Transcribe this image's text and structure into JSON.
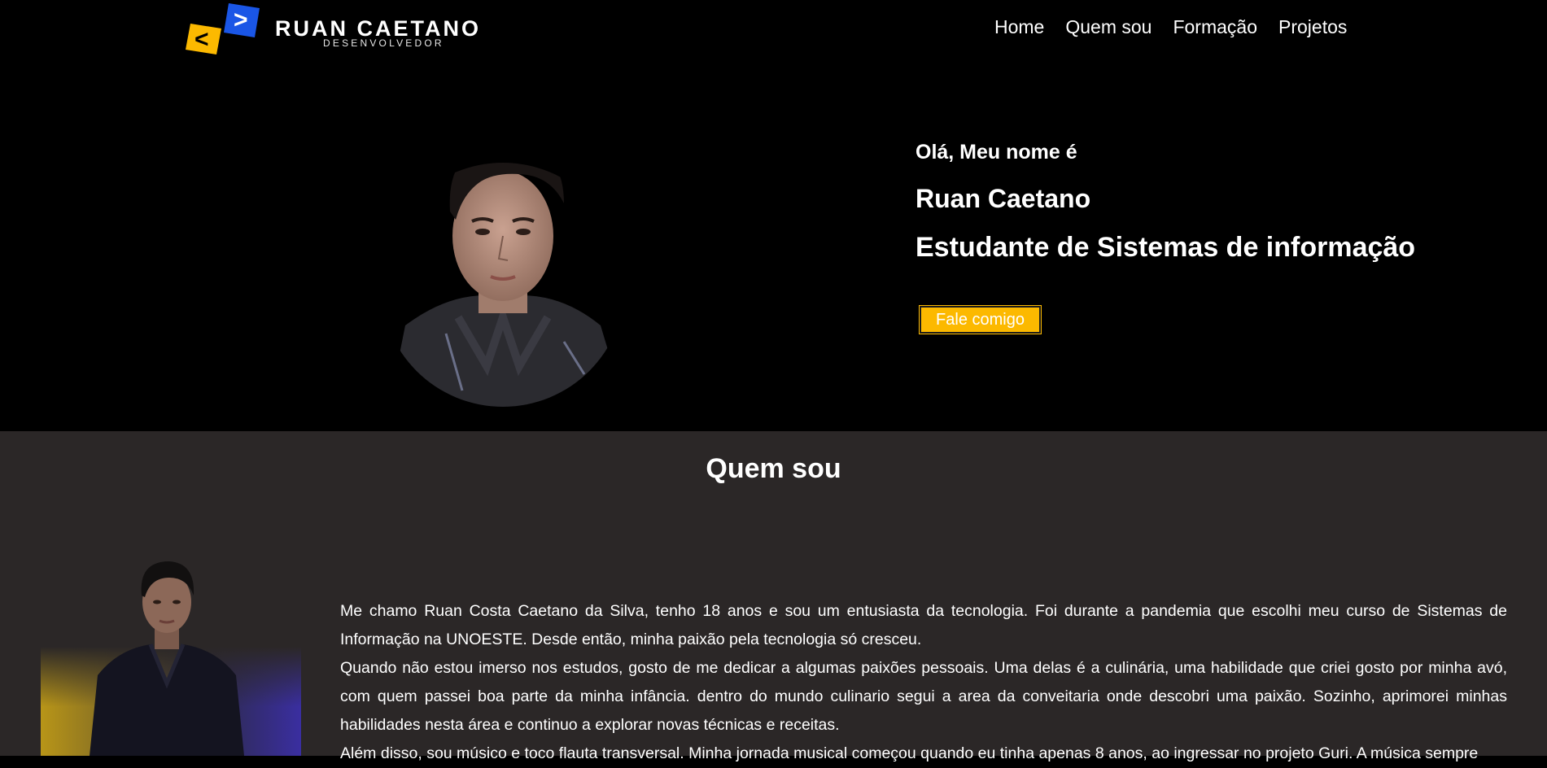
{
  "brand": {
    "name": "RUAN CAETANO",
    "subtitle": "DESENVOLVEDOR",
    "left_glyph": "<",
    "right_glyph": ">",
    "colors": {
      "yellow": "#fcb900",
      "blue": "#1a56e6"
    }
  },
  "nav": {
    "items": [
      {
        "label": "Home"
      },
      {
        "label": "Quem sou"
      },
      {
        "label": "Formação"
      },
      {
        "label": "Projetos"
      }
    ]
  },
  "hero": {
    "greeting": "Olá, Meu nome é",
    "name": "Ruan Caetano",
    "role": "Estudante de Sistemas de informação",
    "cta_label": "Fale comigo",
    "cta_color": "#fcb900"
  },
  "about": {
    "title": "Quem sou",
    "background": "#2b2727",
    "paragraphs": [
      "Me chamo Ruan Costa Caetano da Silva, tenho 18 anos e sou um entusiasta da tecnologia. Foi durante a pandemia que escolhi meu curso de Sistemas de Informação na UNOESTE. Desde então, minha paixão pela tecnologia só cresceu.",
      "Quando não estou imerso nos estudos, gosto de me dedicar a algumas paixões pessoais. Uma delas é a culinária, uma habilidade que criei gosto por minha avó, com quem passei boa parte da minha infância. dentro do mundo culinario segui a area da conveitaria onde descobri uma paixão. Sozinho, aprimorei minhas habilidades nesta área e continuo a explorar novas técnicas e receitas.",
      "Além disso, sou músico e toco flauta transversal. Minha jornada musical começou quando eu tinha apenas 8 anos, ao ingressar no projeto Guri. A música sempre"
    ]
  }
}
